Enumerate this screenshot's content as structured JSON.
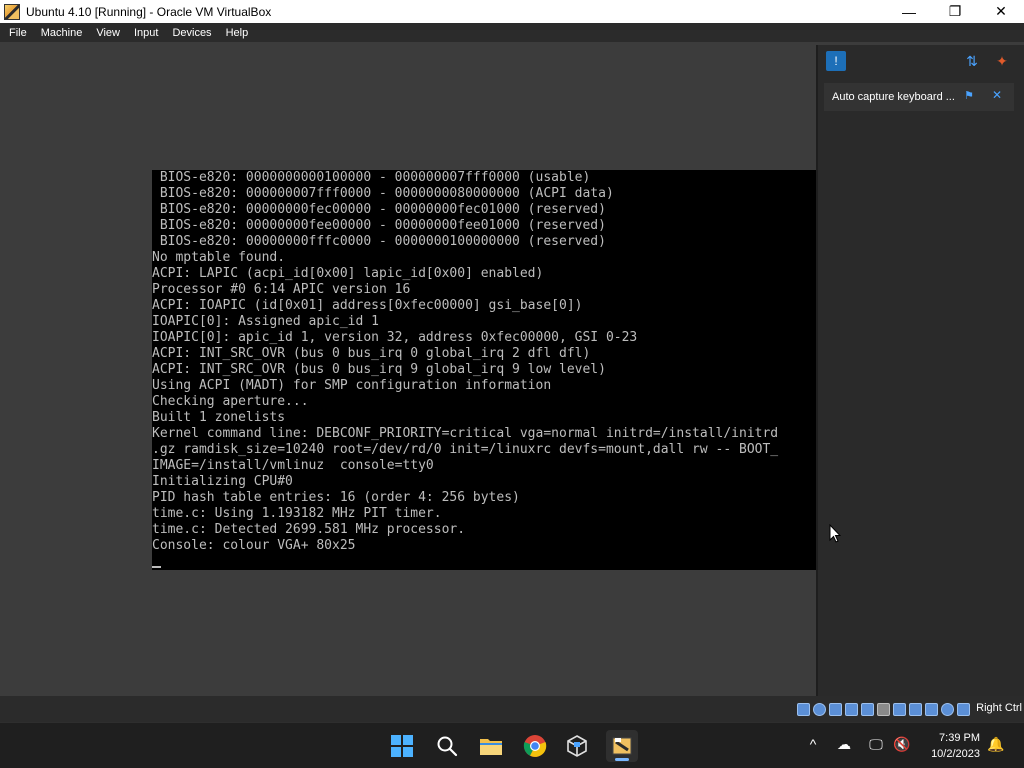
{
  "window": {
    "title": "Ubuntu 4.10 [Running] - Oracle VM VirtualBox",
    "minimize": "—",
    "maximize": "❐",
    "close": "✕"
  },
  "menu": [
    "File",
    "Machine",
    "View",
    "Input",
    "Devices",
    "Help"
  ],
  "console": {
    "lines": [
      " BIOS-e820: 0000000000100000 - 000000007fff0000 (usable)",
      " BIOS-e820: 000000007fff0000 - 0000000080000000 (ACPI data)",
      " BIOS-e820: 00000000fec00000 - 00000000fec01000 (reserved)",
      " BIOS-e820: 00000000fee00000 - 00000000fee01000 (reserved)",
      " BIOS-e820: 00000000fffc0000 - 0000000100000000 (reserved)",
      "No mptable found.",
      "ACPI: LAPIC (acpi_id[0x00] lapic_id[0x00] enabled)",
      "Processor #0 6:14 APIC version 16",
      "ACPI: IOAPIC (id[0x01] address[0xfec00000] gsi_base[0])",
      "IOAPIC[0]: Assigned apic_id 1",
      "IOAPIC[0]: apic_id 1, version 32, address 0xfec00000, GSI 0-23",
      "ACPI: INT_SRC_OVR (bus 0 bus_irq 0 global_irq 2 dfl dfl)",
      "ACPI: INT_SRC_OVR (bus 0 bus_irq 9 global_irq 9 low level)",
      "Using ACPI (MADT) for SMP configuration information",
      "Checking aperture...",
      "Built 1 zonelists",
      "Kernel command line: DEBCONF_PRIORITY=critical vga=normal initrd=/install/initrd",
      ".gz ramdisk_size=10240 root=/dev/rd/0 init=/linuxrc devfs=mount,dall rw -- BOOT_",
      "IMAGE=/install/vmlinuz  console=tty0",
      "Initializing CPU#0",
      "PID hash table entries: 16 (order 4: 256 bytes)",
      "time.c: Using 1.193182 MHz PIT timer.",
      "time.c: Detected 2699.581 MHz processor.",
      "Console: colour VGA+ 80x25"
    ]
  },
  "notification_panel": {
    "toggle_icon": "notification-center-icon",
    "card_text": "Auto capture keyboard ..."
  },
  "statusbar": {
    "host_key": "Right Ctrl"
  },
  "taskbar": {
    "time": "7:39 PM",
    "date": "10/2/2023",
    "tray_chevron": "^"
  }
}
